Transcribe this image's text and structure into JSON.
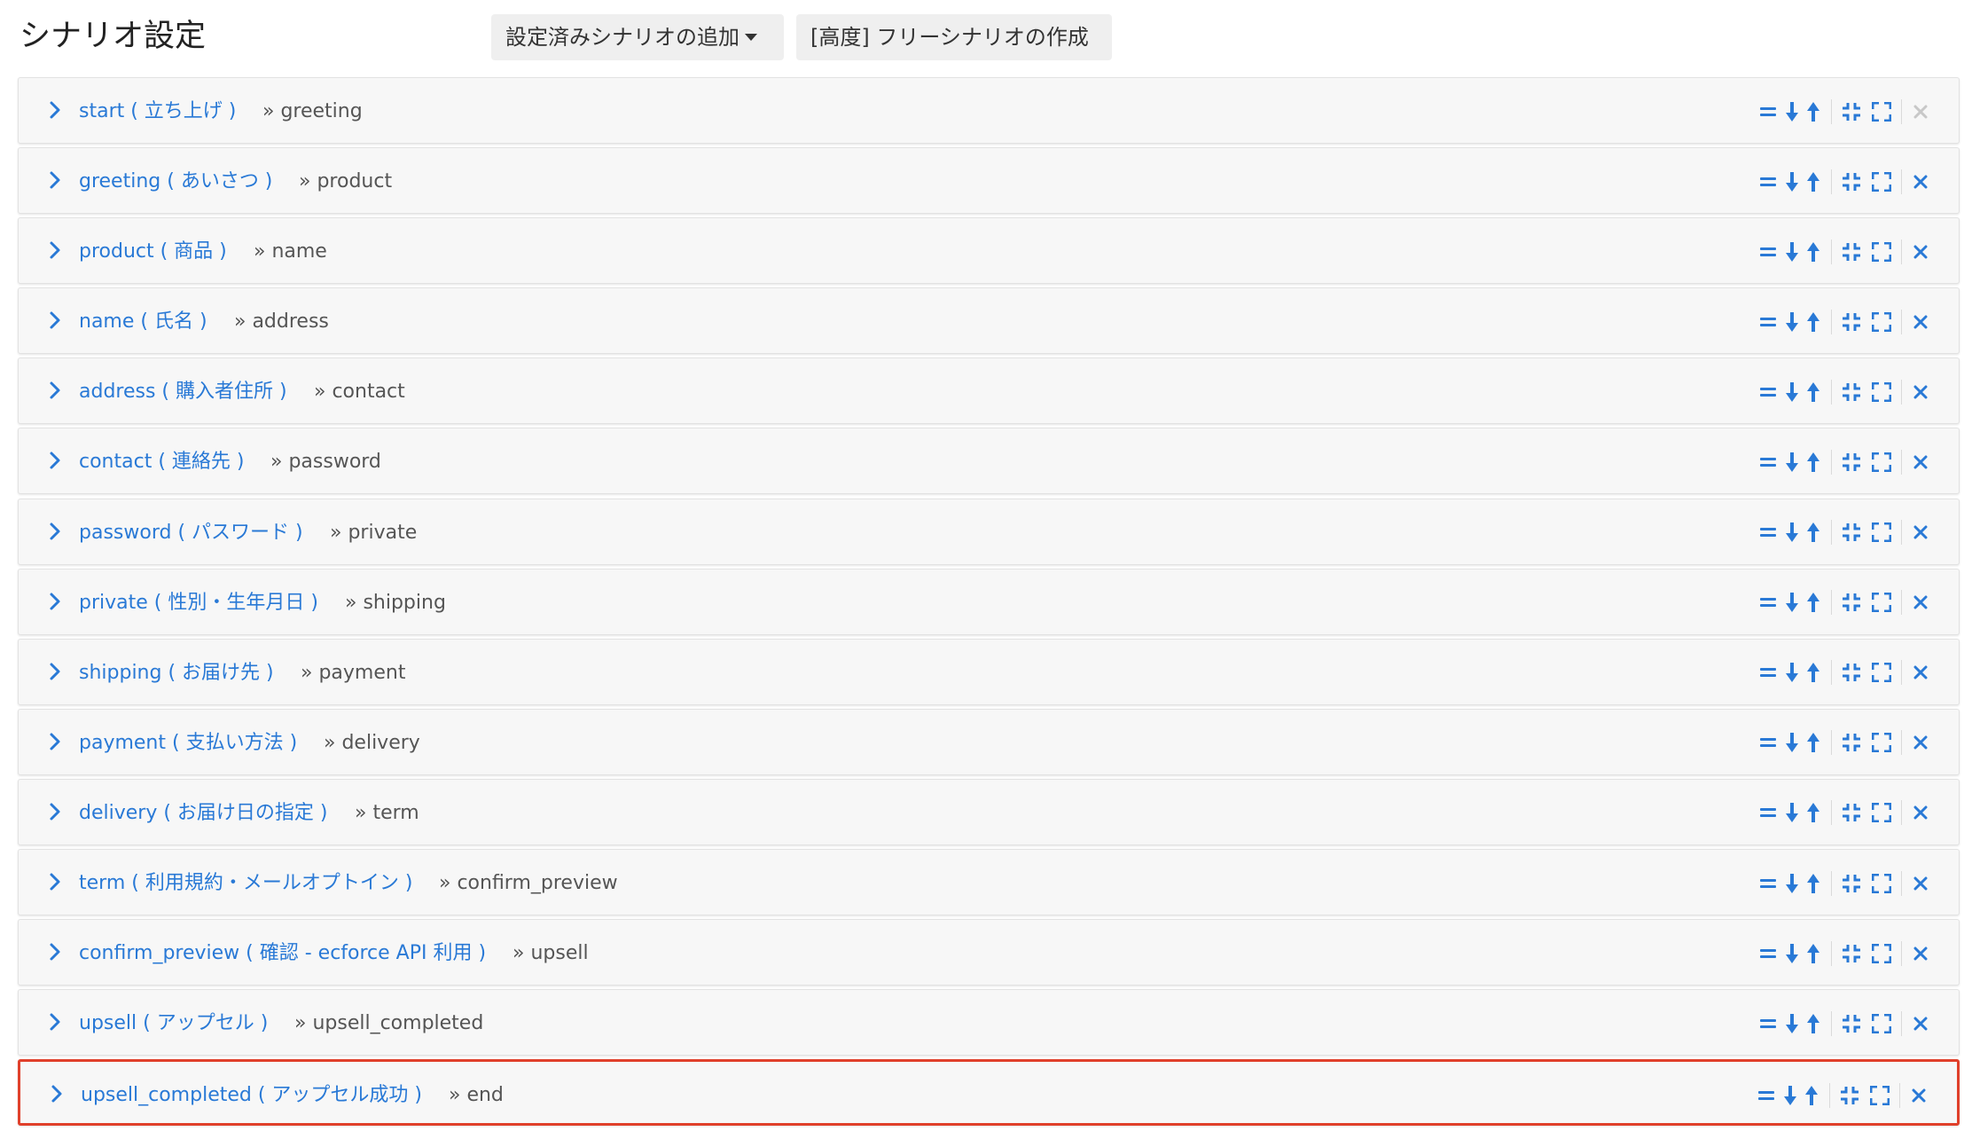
{
  "header": {
    "title": "シナリオ設定",
    "add_button_label": "設定済みシナリオの追加",
    "free_button_label": "[高度] フリーシナリオの作成"
  },
  "colors": {
    "link": "#2979d6",
    "icon": "#2979d6",
    "icon_disabled": "#c8c8c8",
    "selected_border": "#e0402b",
    "row_bg": "#f7f7f7"
  },
  "scenarios": [
    {
      "name": "start ( 立ち上げ )",
      "next": "» greeting"
    },
    {
      "name": "greeting ( あいさつ )",
      "next": "» product"
    },
    {
      "name": "product ( 商品 )",
      "next": "» name"
    },
    {
      "name": "name ( 氏名 )",
      "next": "» address"
    },
    {
      "name": "address ( 購入者住所 )",
      "next": "» contact"
    },
    {
      "name": "contact ( 連絡先 )",
      "next": "» password"
    },
    {
      "name": "password ( パスワード )",
      "next": "» private"
    },
    {
      "name": "private ( 性別・生年月日 )",
      "next": "» shipping"
    },
    {
      "name": "shipping ( お届け先 )",
      "next": "» payment"
    },
    {
      "name": "payment ( 支払い方法 )",
      "next": "» delivery"
    },
    {
      "name": "delivery ( お届け日の指定 )",
      "next": "» term"
    },
    {
      "name": "term ( 利用規約・メールオプトイン )",
      "next": "» confirm_preview"
    },
    {
      "name": "confirm_preview ( 確認 - ecforce API 利用 )",
      "next": "» upsell"
    },
    {
      "name": "upsell ( アップセル )",
      "next": "» upsell_completed"
    },
    {
      "name": "upsell_completed ( アップセル成功 )",
      "next": "» end"
    }
  ],
  "row_icons": [
    "drag-handle-icon",
    "arrow-down-icon",
    "arrow-up-icon",
    "compress-icon",
    "expand-icon",
    "close-icon"
  ],
  "disabled_delete_rows": [
    0
  ],
  "selected_row": 14
}
